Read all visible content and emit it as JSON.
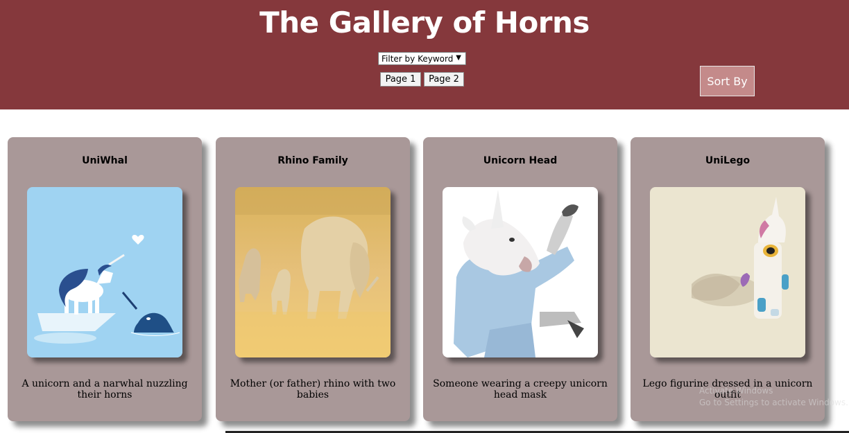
{
  "header": {
    "title": "The Gallery of Horns",
    "filter": {
      "selected": "Filter by Keyword"
    },
    "pages": [
      "Page 1",
      "Page 2"
    ],
    "sort_label": "Sort By"
  },
  "cards": [
    {
      "title": "UniWhal",
      "description": "A unicorn and a narwhal nuzzling their horns",
      "image": "unicorn-narwhal-illustration"
    },
    {
      "title": "Rhino Family",
      "description": "Mother (or father) rhino with two babies",
      "image": "rhino-family-photo"
    },
    {
      "title": "Unicorn Head",
      "description": "Someone wearing a creepy unicorn head mask",
      "image": "unicorn-mask-photo"
    },
    {
      "title": "UniLego",
      "description": "Lego figurine dressed in a unicorn outfit",
      "image": "lego-unicorn-photo"
    }
  ],
  "watermark": {
    "line1": "Activate Windows",
    "line2": "Go to Settings to activate Windows."
  },
  "colors": {
    "header_bg": "#85383c",
    "card_bg": "#a99898",
    "sort_button_bg": "#c48a8a"
  }
}
